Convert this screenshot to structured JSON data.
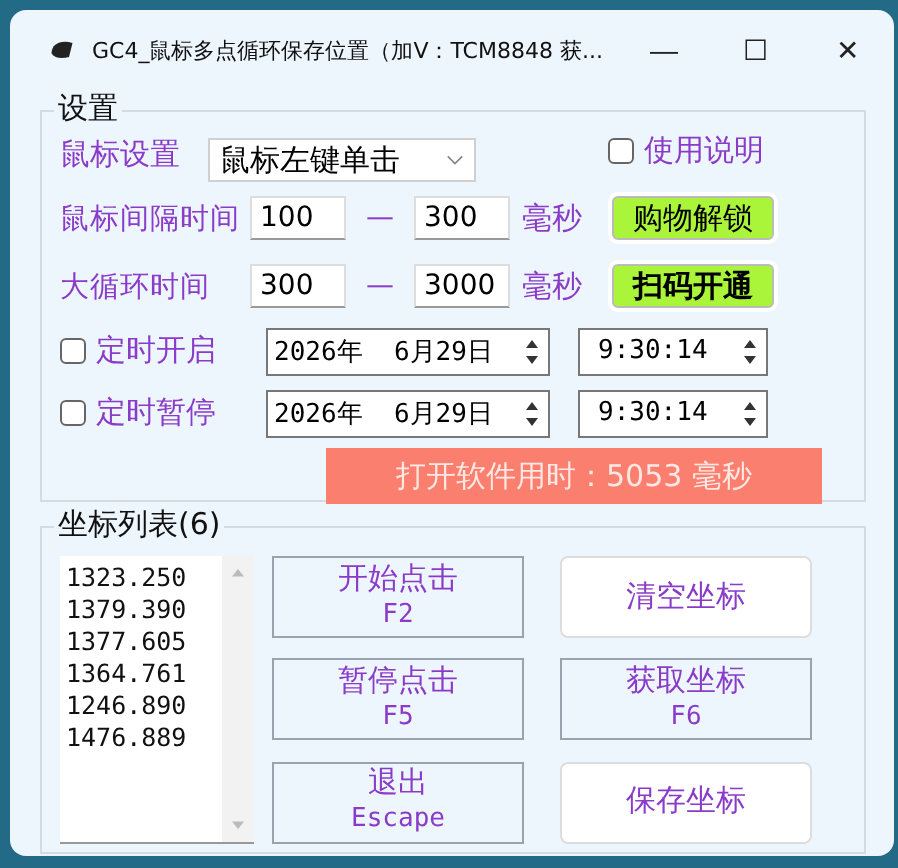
{
  "window": {
    "title": "GC4_鼠标多点循环保存位置（加V：TCM8848 获...",
    "controls": [
      "—",
      "☐",
      "✕"
    ]
  },
  "settings": {
    "title": "设置",
    "mouse_label": "鼠标设置",
    "mouse_mode": "鼠标左键单击",
    "help": {
      "label": "使用说明",
      "checked": false
    },
    "ranges": [
      {
        "label": "鼠标间隔时间",
        "min": "100",
        "dash": "—",
        "max": "300",
        "unit": "毫秒",
        "button": "购物解锁",
        "bold": false
      },
      {
        "label": "大循环时间",
        "min": "300",
        "dash": "—",
        "max": "3000",
        "unit": "毫秒",
        "button": "扫码开通",
        "bold": true
      }
    ],
    "timers": [
      {
        "label": "定时开启",
        "checked": false,
        "date": "2026年  6月29日",
        "time": "9:30:14"
      },
      {
        "label": "定时暂停",
        "checked": false,
        "date": "2026年  6月29日",
        "time": "9:30:14"
      }
    ]
  },
  "banner": "打开软件用时：5053 毫秒",
  "coords": {
    "title": "坐标列表(6)",
    "items": [
      "1323.250",
      "1379.390",
      "1377.605",
      "1364.761",
      "1246.890",
      "1476.889"
    ]
  },
  "buttons": [
    {
      "label": "开始点击",
      "key": "F2",
      "kind": "flat"
    },
    {
      "label": "清空坐标",
      "kind": "raised"
    },
    {
      "label": "暂停点击",
      "key": "F5",
      "kind": "flat"
    },
    {
      "label": "获取坐标",
      "key": "F6",
      "kind": "flat"
    },
    {
      "label": "退出",
      "key": "Escape",
      "kind": "flat"
    },
    {
      "label": "保存坐标",
      "kind": "raised"
    }
  ]
}
